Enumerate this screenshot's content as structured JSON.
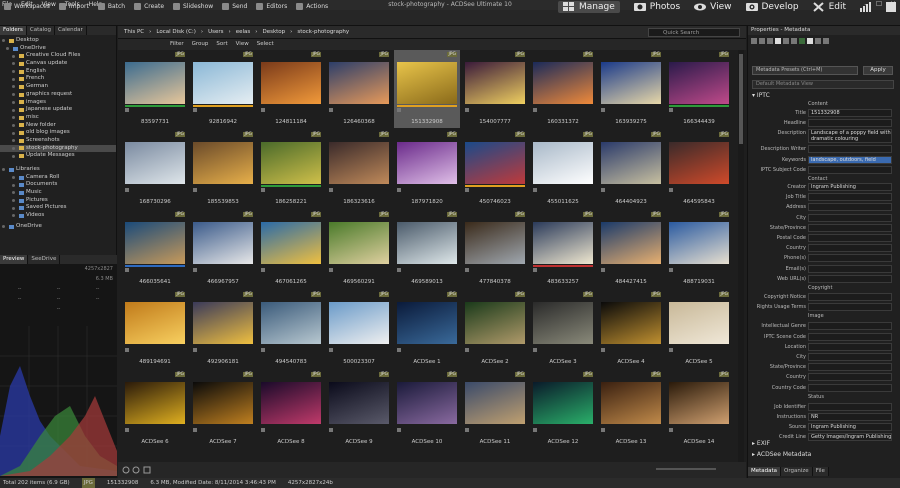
{
  "window": {
    "title": "stock-photography - ACDSee Ultimate 10"
  },
  "menu": [
    "File",
    "Edit",
    "View",
    "Tools",
    "Help"
  ],
  "toolbar": {
    "tools": [
      "Workspaces",
      "Import",
      "Batch",
      "Create",
      "Slideshow",
      "Send",
      "Editors",
      "Actions"
    ],
    "modes": [
      "Manage",
      "Photos",
      "View",
      "Develop",
      "Edit"
    ]
  },
  "left": {
    "tabs": [
      "Folders",
      "Catalog",
      "Calendar"
    ],
    "tree": [
      "Desktop",
      "OneDrive",
      "Creative Cloud Files",
      "Canvas update",
      "English",
      "French",
      "German",
      "graphics request",
      "images",
      "Japanese update",
      "misc",
      "New folder",
      "old blog images",
      "Screenshots",
      "stock-photography",
      "Update Messages"
    ],
    "libraries": [
      "Libraries",
      "Camera Roll",
      "Documents",
      "Music",
      "Pictures",
      "Saved Pictures",
      "Videos"
    ],
    "onedrive": "OneDrive",
    "preview_tabs": [
      "Preview",
      "SeeDrive"
    ],
    "preview_info": {
      "dimensions": "4257x2827",
      "size": "6.3 MB",
      "dashes": "--"
    }
  },
  "address": {
    "crumbs": [
      "This PC",
      "Local Disk (C:)",
      "Users",
      "eelas",
      "Desktop",
      "stock-photography"
    ],
    "search_placeholder": "Quick Search"
  },
  "filters": [
    "Filter",
    "Group",
    "Sort",
    "View",
    "Select"
  ],
  "thumbs": [
    {
      "name": "83597731",
      "badge": "JPG",
      "c1": "#3b6b8f",
      "c2": "#e8c79a",
      "label": "#2d9b3a"
    },
    {
      "name": "92816942",
      "badge": "JPG",
      "c1": "#8ab7d6",
      "c2": "#e6eef2",
      "label": "#e0a020"
    },
    {
      "name": "124811184",
      "badge": "JPG",
      "c1": "#7a3a1a",
      "c2": "#f29a3a",
      "label": ""
    },
    {
      "name": "126460368",
      "badge": "JPG",
      "c1": "#2c3e6a",
      "c2": "#e89a5a",
      "label": ""
    },
    {
      "name": "151332908",
      "badge": "JPG",
      "c1": "#e8c44a",
      "c2": "#8a6a1a",
      "label": "#e0a020"
    },
    {
      "name": "154007777",
      "badge": "JPG",
      "c1": "#3a1a3a",
      "c2": "#f0d060",
      "label": ""
    },
    {
      "name": "160331372",
      "badge": "JPG",
      "c1": "#1a2a5a",
      "c2": "#f08a3a",
      "label": ""
    },
    {
      "name": "163939275",
      "badge": "JPG",
      "c1": "#1a3a8a",
      "c2": "#e8d8a8",
      "label": ""
    },
    {
      "name": "166344439",
      "badge": "JPG",
      "c1": "#2a1a4a",
      "c2": "#c04a8a",
      "label": "#2d9b3a"
    },
    {
      "name": "168730296",
      "badge": "JPG",
      "c1": "#7a8aa0",
      "c2": "#dfe6ea",
      "label": ""
    },
    {
      "name": "185539853",
      "badge": "JPG",
      "c1": "#6a4a2a",
      "c2": "#e8b04a",
      "label": ""
    },
    {
      "name": "186258221",
      "badge": "JPG",
      "c1": "#4a6a2a",
      "c2": "#d0c04a",
      "label": "#2d9b3a"
    },
    {
      "name": "186323616",
      "badge": "JPG",
      "c1": "#3a2a2a",
      "c2": "#c08a5a",
      "label": ""
    },
    {
      "name": "187971820",
      "badge": "JPG",
      "c1": "#6a2a8a",
      "c2": "#e0c0e8",
      "label": ""
    },
    {
      "name": "450746023",
      "badge": "JPG",
      "c1": "#1a4a8a",
      "c2": "#c03a3a",
      "label": "#e0a020"
    },
    {
      "name": "455011625",
      "badge": "JPG",
      "c1": "#a8b8c8",
      "c2": "#ffffff",
      "label": ""
    },
    {
      "name": "464404923",
      "badge": "JPG",
      "c1": "#2a3a6a",
      "c2": "#c8c0a0",
      "label": ""
    },
    {
      "name": "464595843",
      "badge": "JPG",
      "c1": "#3a2a2a",
      "c2": "#d04a2a",
      "label": ""
    },
    {
      "name": "466035641",
      "badge": "JPG",
      "c1": "#1a4a7a",
      "c2": "#c89a5a",
      "label": "#2d6ac0"
    },
    {
      "name": "466967957",
      "badge": "JPG",
      "c1": "#3a5a8a",
      "c2": "#e8e8e8",
      "label": ""
    },
    {
      "name": "467061265",
      "badge": "JPG",
      "c1": "#2a6aa8",
      "c2": "#f0c040",
      "label": ""
    },
    {
      "name": "469560291",
      "badge": "JPG",
      "c1": "#4a7a2a",
      "c2": "#e0d0a0",
      "label": ""
    },
    {
      "name": "469589013",
      "badge": "JPG",
      "c1": "#4a5a6a",
      "c2": "#dfe8ea",
      "label": ""
    },
    {
      "name": "477840378",
      "badge": "JPG",
      "c1": "#3a2a1a",
      "c2": "#a0a8b0",
      "label": ""
    },
    {
      "name": "483633257",
      "badge": "JPG",
      "c1": "#2a3a5a",
      "c2": "#f0e8d0",
      "label": "#c03030"
    },
    {
      "name": "484427415",
      "badge": "JPG",
      "c1": "#1a3a6a",
      "c2": "#e8b070",
      "label": ""
    },
    {
      "name": "488719031",
      "badge": "JPG",
      "c1": "#2a5aa0",
      "c2": "#e8e0d0",
      "label": ""
    },
    {
      "name": "489194691",
      "badge": "JPG",
      "c1": "#c07a1a",
      "c2": "#f8d060",
      "label": ""
    },
    {
      "name": "492906181",
      "badge": "JPG",
      "c1": "#3a3a5a",
      "c2": "#f0c040",
      "label": ""
    },
    {
      "name": "494540783",
      "badge": "JPG",
      "c1": "#3a5a7a",
      "c2": "#b8c8d0",
      "label": ""
    },
    {
      "name": "500023307",
      "badge": "JPG",
      "c1": "#6a9ac8",
      "c2": "#f0f0f0",
      "label": ""
    },
    {
      "name": "ACDSee 1",
      "badge": "JPG",
      "c1": "#0a1a3a",
      "c2": "#3a6a9a",
      "label": ""
    },
    {
      "name": "ACDSee 2",
      "badge": "JPG",
      "c1": "#1a3a1a",
      "c2": "#b09a6a",
      "label": ""
    },
    {
      "name": "ACDSee 3",
      "badge": "JPG",
      "c1": "#2a2a2a",
      "c2": "#8a8a7a",
      "label": ""
    },
    {
      "name": "ACDSee 4",
      "badge": "JPG",
      "c1": "#0a0a0a",
      "c2": "#c09030",
      "label": ""
    },
    {
      "name": "ACDSee 5",
      "badge": "JPG",
      "c1": "#c8b898",
      "c2": "#f0e8d8",
      "label": ""
    },
    {
      "name": "ACDSee 6",
      "badge": "JPG",
      "c1": "#2a1a0a",
      "c2": "#e0b020",
      "label": ""
    },
    {
      "name": "ACDSee 7",
      "badge": "JPG",
      "c1": "#0a0a0a",
      "c2": "#c08020",
      "label": ""
    },
    {
      "name": "ACDSee 8",
      "badge": "JPG",
      "c1": "#1a0a2a",
      "c2": "#c03a6a",
      "label": ""
    },
    {
      "name": "ACDSee 9",
      "badge": "JPG",
      "c1": "#0a0a1a",
      "c2": "#5a5a6a",
      "label": ""
    },
    {
      "name": "ACDSee 10",
      "badge": "JPG",
      "c1": "#1a1a3a",
      "c2": "#8a6aa0",
      "label": ""
    },
    {
      "name": "ACDSee 11",
      "badge": "JPG",
      "c1": "#3a4a6a",
      "c2": "#c0a070",
      "label": ""
    },
    {
      "name": "ACDSee 12",
      "badge": "JPG",
      "c1": "#0a1a2a",
      "c2": "#2ab06a",
      "label": ""
    },
    {
      "name": "ACDSee 13",
      "badge": "JPG",
      "c1": "#3a2010",
      "c2": "#c08a4a",
      "label": ""
    },
    {
      "name": "ACDSee 14",
      "badge": "JPG",
      "c1": "#2a1a0a",
      "c2": "#d0a070",
      "label": ""
    }
  ],
  "right": {
    "header": "Properties - Metadata",
    "presets": "Metadata Presets (Ctrl+M)",
    "apply": "Apply",
    "default_view": "Default Metadata View",
    "iptc": "IPTC",
    "content_label": "Content",
    "fields": [
      {
        "label": "Title",
        "value": "151332908"
      },
      {
        "label": "Headline",
        "value": ""
      },
      {
        "label": "Description",
        "value": "Landscape of a poppy field with dramatic colouring"
      },
      {
        "label": "Description Writer",
        "value": ""
      },
      {
        "label": "Keywords",
        "value": "landscape, outdoors, field"
      },
      {
        "label": "IPTC Subject Code",
        "value": ""
      }
    ],
    "contact_label": "Contact",
    "contact_fields": [
      {
        "label": "Creator",
        "value": "Ingram Publishing"
      },
      {
        "label": "Job Title",
        "value": ""
      },
      {
        "label": "Address",
        "value": ""
      },
      {
        "label": "City",
        "value": ""
      },
      {
        "label": "State/Province",
        "value": ""
      },
      {
        "label": "Postal Code",
        "value": ""
      },
      {
        "label": "Country",
        "value": ""
      },
      {
        "label": "Phone(s)",
        "value": ""
      },
      {
        "label": "Email(s)",
        "value": ""
      },
      {
        "label": "Web URL(s)",
        "value": ""
      }
    ],
    "copyright_label": "Copyright",
    "copyright_fields": [
      {
        "label": "Copyright Notice",
        "value": ""
      },
      {
        "label": "Rights Usage Terms",
        "value": ""
      }
    ],
    "image_label": "Image",
    "image_fields": [
      {
        "label": "Intellectual Genre",
        "value": ""
      },
      {
        "label": "IPTC Scene Code",
        "value": ""
      },
      {
        "label": "Location",
        "value": ""
      },
      {
        "label": "City",
        "value": ""
      },
      {
        "label": "State/Province",
        "value": ""
      },
      {
        "label": "Country",
        "value": ""
      },
      {
        "label": "Country Code",
        "value": ""
      }
    ],
    "status_label": "Status",
    "status_fields": [
      {
        "label": "Job Identifier",
        "value": ""
      },
      {
        "label": "Instructions",
        "value": "NR"
      },
      {
        "label": "Source",
        "value": "Ingram Publishing"
      },
      {
        "label": "Credit Line",
        "value": "Getty Images/Ingram Publishing"
      }
    ],
    "exif": "EXIF",
    "acdsee_meta": "ACDSee Metadata",
    "tabs": [
      "Metadata",
      "Organize",
      "File"
    ]
  },
  "status": {
    "total": "Total 202 items (6.9 GB)",
    "type": "JPG",
    "name": "151332908",
    "modified": "6.3 MB, Modified Date: 8/11/2014 3:46:43 PM",
    "dims": "4257x2827x24b"
  }
}
